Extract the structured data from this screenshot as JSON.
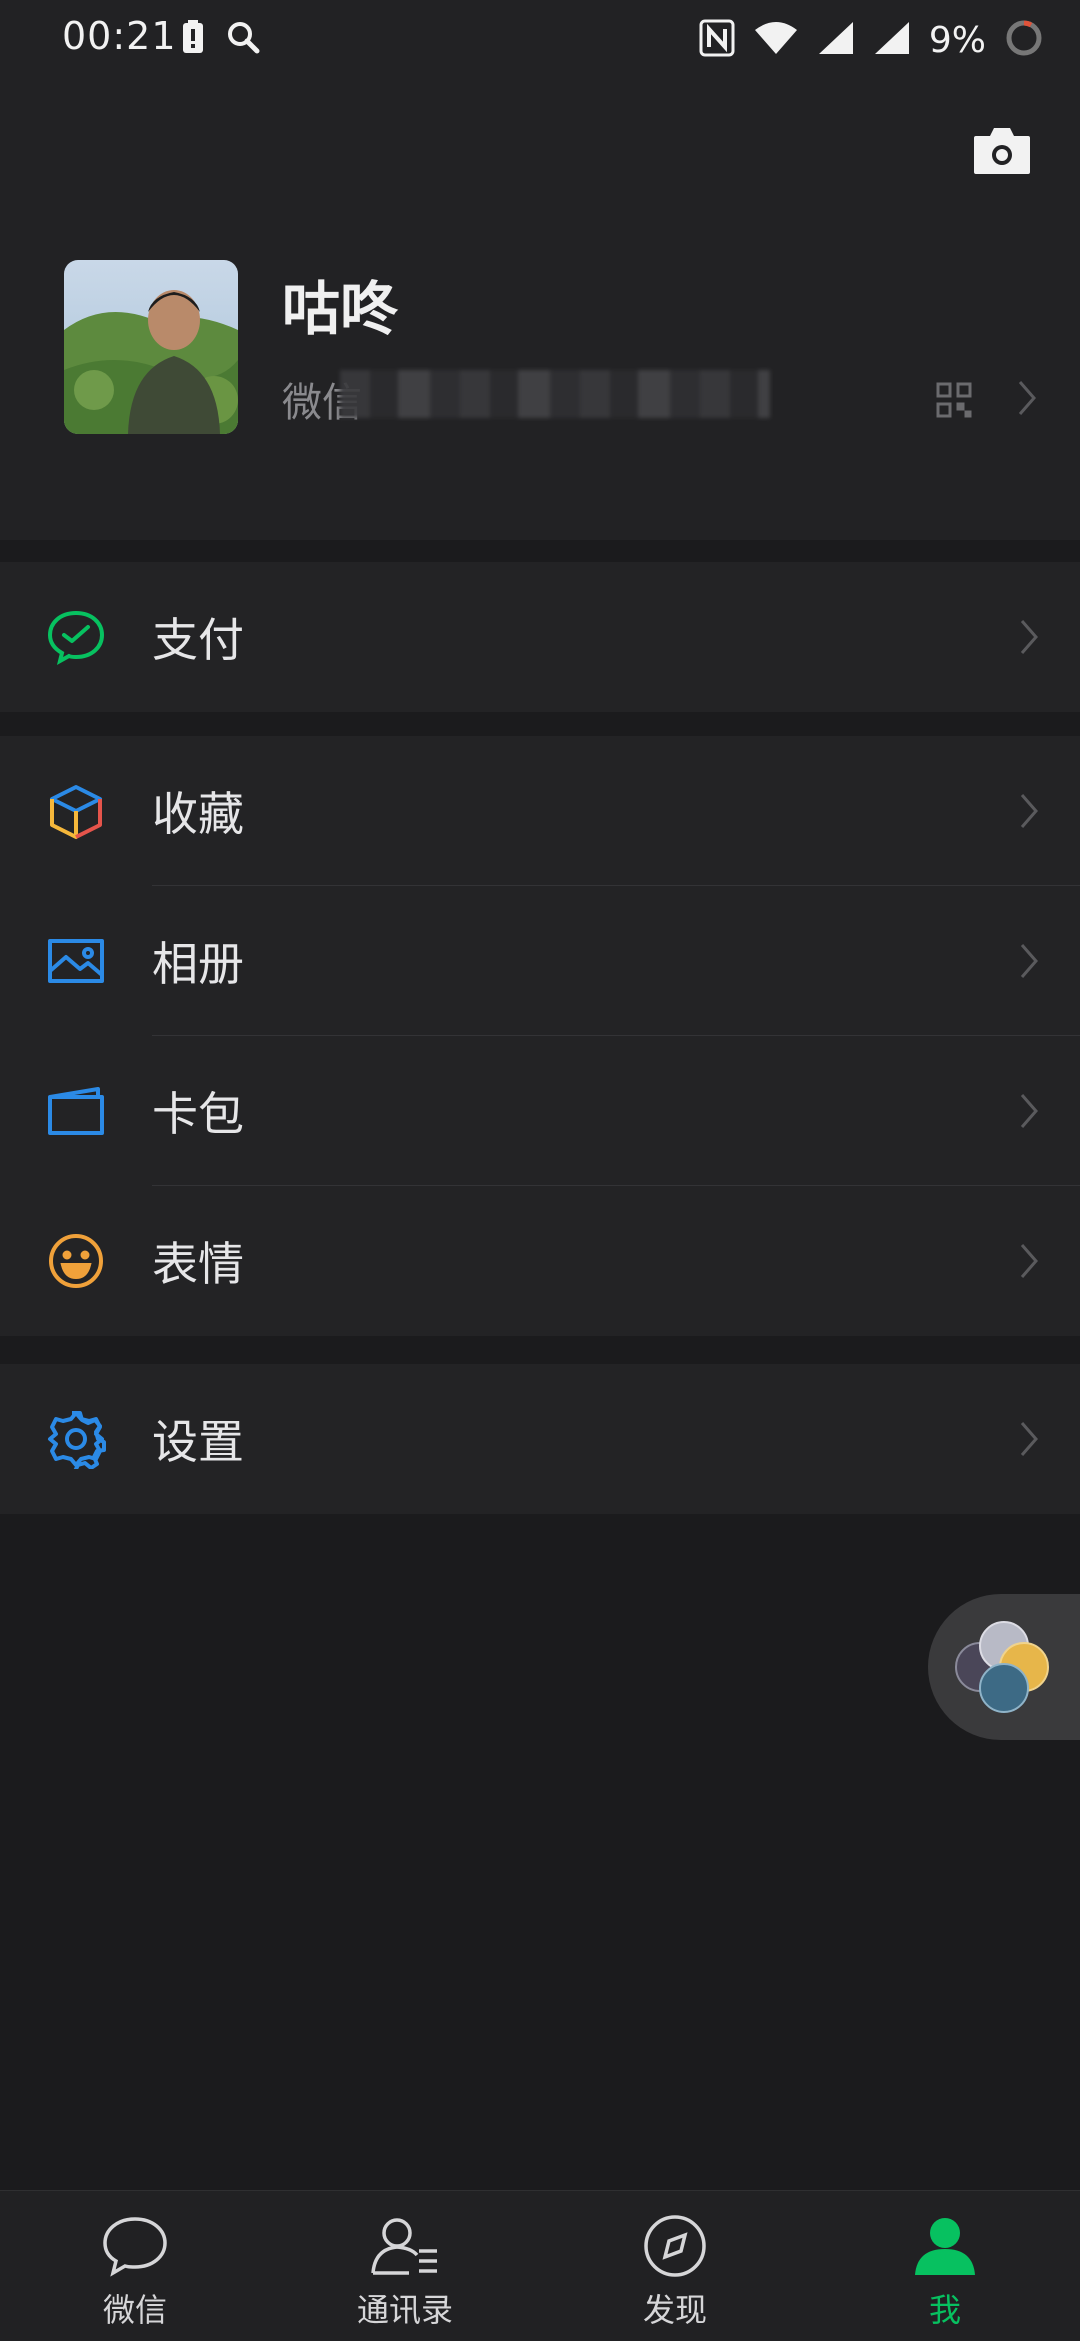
{
  "status_bar": {
    "time": "00:21",
    "battery": "9%"
  },
  "profile": {
    "name": "咕咚",
    "wechat_id_label": "微信"
  },
  "menu_groups": [
    [
      {
        "label": "支付",
        "icon": "pay-icon"
      }
    ],
    [
      {
        "label": "收藏",
        "icon": "favorites-icon"
      },
      {
        "label": "相册",
        "icon": "album-icon"
      },
      {
        "label": "卡包",
        "icon": "card-wallet-icon"
      },
      {
        "label": "表情",
        "icon": "sticker-icon"
      }
    ],
    [
      {
        "label": "设置",
        "icon": "settings-icon"
      }
    ]
  ],
  "bottom_nav": [
    {
      "label": "微信",
      "icon": "chat-icon",
      "active": false
    },
    {
      "label": "通讯录",
      "icon": "contacts-icon",
      "active": false
    },
    {
      "label": "发现",
      "icon": "discover-icon",
      "active": false
    },
    {
      "label": "我",
      "icon": "me-icon",
      "active": true
    }
  ],
  "colors": {
    "accent": "#07c160",
    "background": "#1b1b1d",
    "panel": "#232325"
  }
}
